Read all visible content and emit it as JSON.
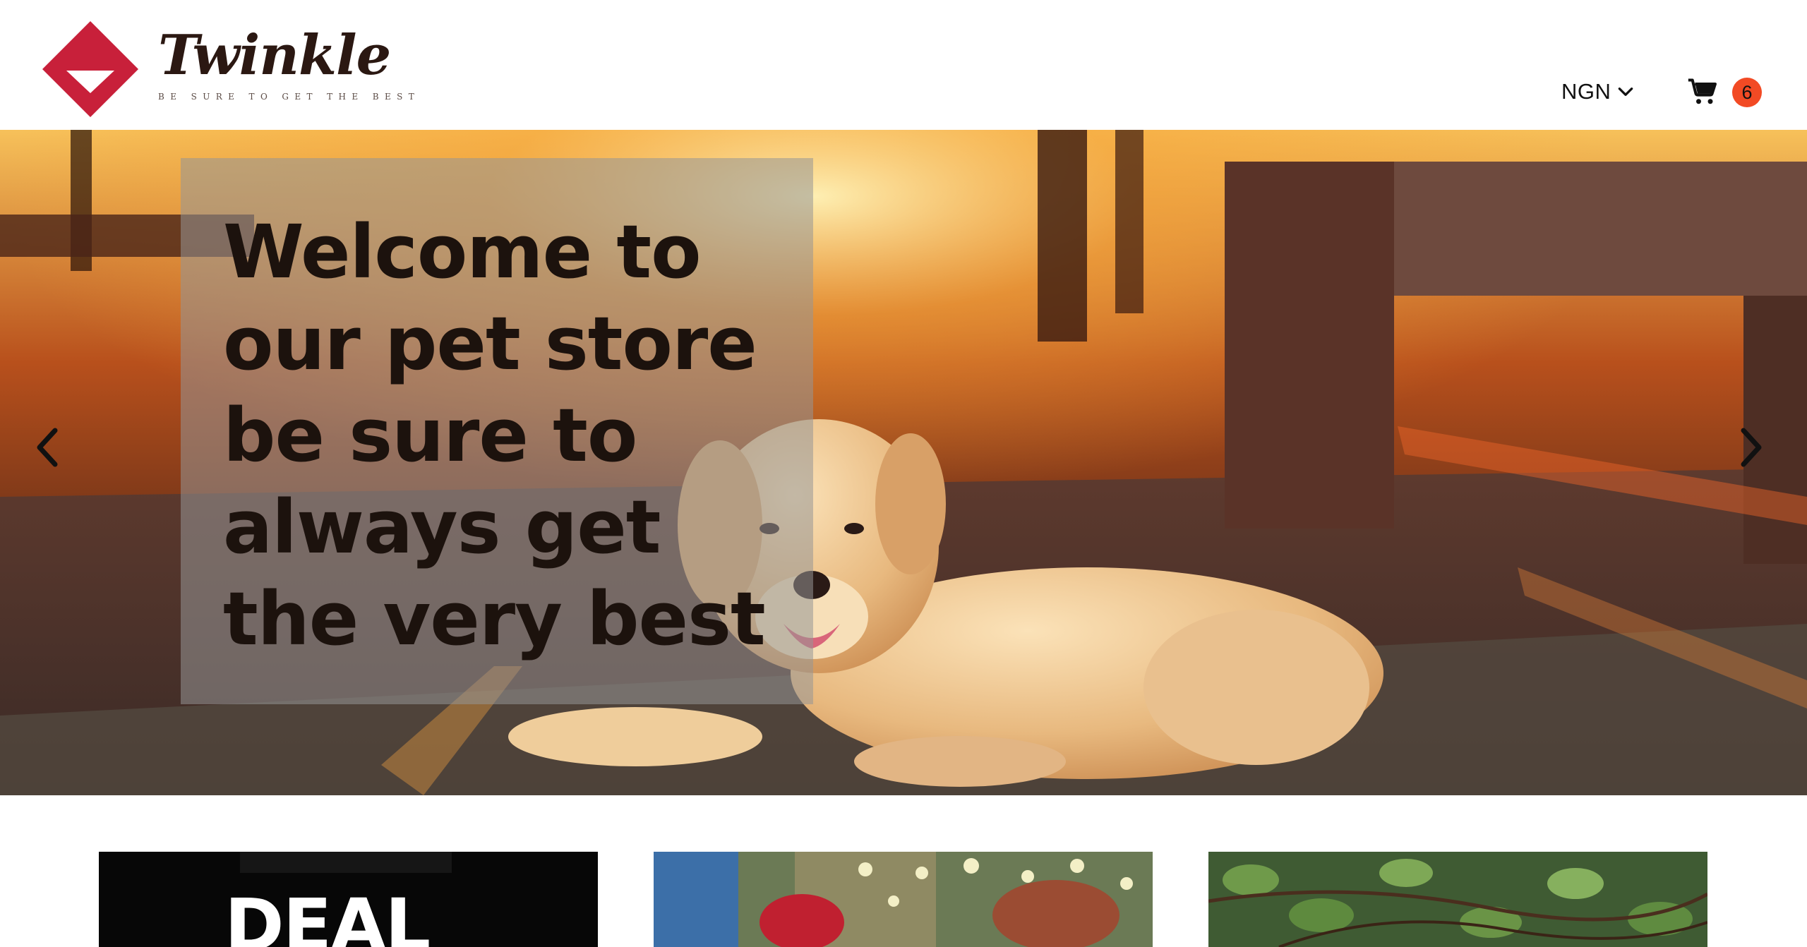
{
  "header": {
    "brand_name": "Twinkle",
    "brand_tagline": "BE SURE TO GET THE BEST",
    "currency": {
      "selected": "NGN",
      "icon": "chevron-down-icon"
    },
    "cart": {
      "icon": "shopping-cart-icon",
      "count": "6"
    }
  },
  "hero": {
    "heading": "Welcome to our pet store be sure to always get the very best",
    "prev_icon": "chevron-left-icon",
    "next_icon": "chevron-right-icon"
  },
  "promos": [
    {
      "label": "DEAL"
    },
    {
      "label": ""
    },
    {
      "label": ""
    }
  ],
  "colors": {
    "brand_red": "#c8203a",
    "brand_brown": "#2b1812",
    "badge_orange": "#f24a24"
  }
}
